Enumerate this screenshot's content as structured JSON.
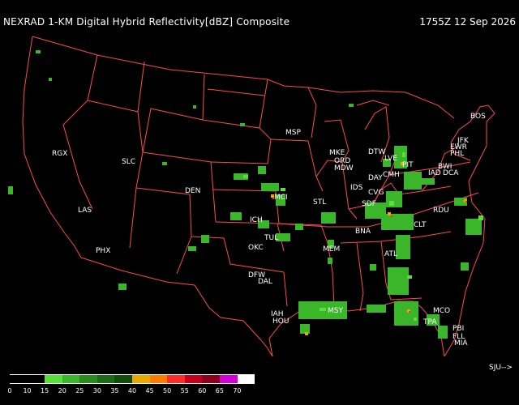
{
  "header": {
    "title": "NEXRAD 1-KM Digital Hybrid Reflectivity[dBZ] Composite",
    "timestamp": "1755Z 12 Sep 2026"
  },
  "credit": "SJU-->",
  "colors": {
    "background": "#000000",
    "borders": "#ff4a4a",
    "text": "#ffffff"
  },
  "legend": {
    "ticks": [
      "0",
      "10",
      "15",
      "20",
      "25",
      "30",
      "35",
      "40",
      "45",
      "50",
      "55",
      "60",
      "65",
      "70"
    ],
    "colors": [
      "#000000",
      "#000000",
      "#5adf3a",
      "#3bb52a",
      "#2a8a1e",
      "#1f6a16",
      "#134d0e",
      "#e7a800",
      "#ff7a00",
      "#ff2b2b",
      "#c4001a",
      "#8b001a",
      "#d200d2",
      "#ffffff"
    ]
  },
  "cities": [
    {
      "code": "BOS"
    },
    {
      "code": "JFK"
    },
    {
      "code": "EWR"
    },
    {
      "code": "PHL"
    },
    {
      "code": "BWI"
    },
    {
      "code": "IAD"
    },
    {
      "code": "DCA"
    },
    {
      "code": "PIT"
    },
    {
      "code": "LVE"
    },
    {
      "code": "CMH"
    },
    {
      "code": "DTW"
    },
    {
      "code": "DAY"
    },
    {
      "code": "CVG"
    },
    {
      "code": "SDF"
    },
    {
      "code": "IDS"
    },
    {
      "code": "MKE"
    },
    {
      "code": "ORD"
    },
    {
      "code": "MDW"
    },
    {
      "code": "MSP"
    },
    {
      "code": "STL"
    },
    {
      "code": "MCI"
    },
    {
      "code": "BNA"
    },
    {
      "code": "CLT"
    },
    {
      "code": "RDU"
    },
    {
      "code": "ATL"
    },
    {
      "code": "MEM"
    },
    {
      "code": "MSY"
    },
    {
      "code": "MCO"
    },
    {
      "code": "TPA"
    },
    {
      "code": "PBI"
    },
    {
      "code": "FLL"
    },
    {
      "code": "MIA"
    },
    {
      "code": "IAH"
    },
    {
      "code": "HOU"
    },
    {
      "code": "DFW"
    },
    {
      "code": "DAL"
    },
    {
      "code": "OKC"
    },
    {
      "code": "TUL"
    },
    {
      "code": "ICH"
    },
    {
      "code": "DEN"
    },
    {
      "code": "SLC"
    },
    {
      "code": "PHX"
    },
    {
      "code": "LAS"
    },
    {
      "code": "RGX"
    }
  ]
}
